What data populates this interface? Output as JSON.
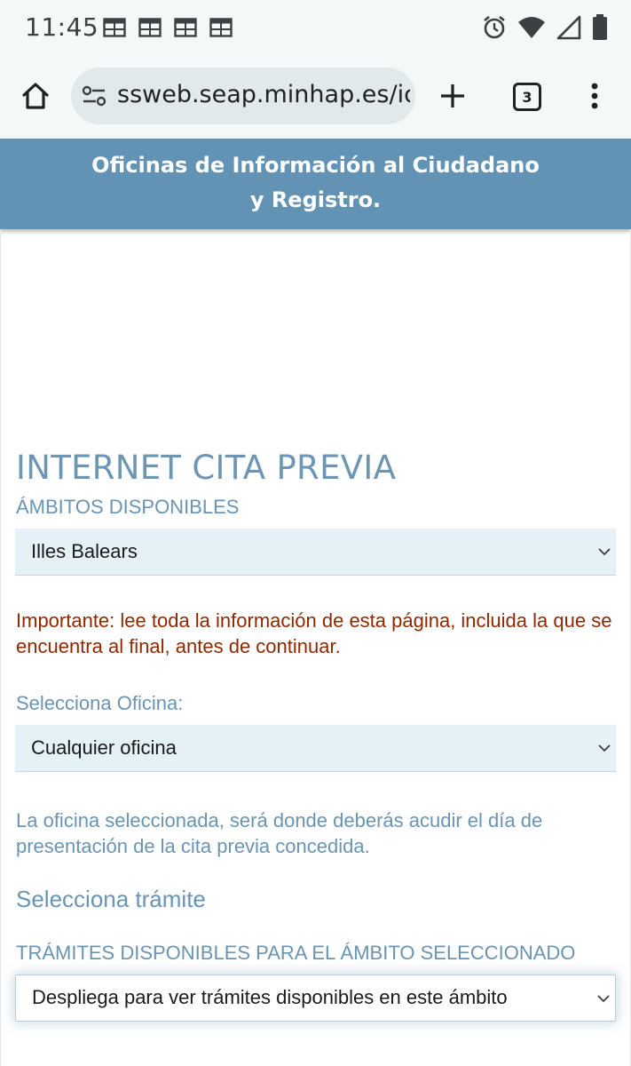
{
  "status_bar": {
    "time": "11:45",
    "notification_icons": [
      "calendar-icon",
      "calendar-icon",
      "calendar-icon",
      "calendar-icon"
    ],
    "system_icons": [
      "alarm-icon",
      "wifi-icon",
      "signal-icon",
      "battery-icon"
    ]
  },
  "browser": {
    "url": "ssweb.seap.minhap.es/ic",
    "tab_count": "3"
  },
  "site_header": {
    "line1": "Oficinas de Información al Ciudadano",
    "line2": "y Registro."
  },
  "main": {
    "title": "INTERNET CITA PREVIA",
    "ambitos_label": "ÁMBITOS DISPONIBLES",
    "ambito_selected": "Illes Balears",
    "important_notice": "Importante: lee toda la información de esta página, incluida la que se encuentra al final, antes de continuar.",
    "oficina_label": "Selecciona Oficina:",
    "oficina_selected": "Cualquier oficina",
    "oficina_info": "La oficina seleccionada, será donde deberás acudir el día de presentación de la cita previa concedida.",
    "tramite_heading": "Selecciona trámite",
    "tramites_label": "TRÁMITES DISPONIBLES PARA EL ÁMBITO SELECCIONADO",
    "tramite_placeholder": "Despliega para ver trámites disponibles en este ámbito"
  },
  "colors": {
    "header_bg": "#6393b4",
    "accent_text": "#6a94b3",
    "important_text": "#8e2900",
    "select_bg": "#e4f1f6",
    "browser_chrome": "#f4f8f8"
  }
}
